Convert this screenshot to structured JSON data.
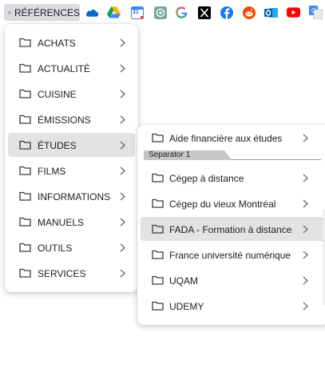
{
  "bookmarks_bar": {
    "folder_label": "RÉFÉRENCES",
    "icons": [
      "onedrive-icon",
      "google-drive-icon",
      "google-calendar-icon",
      "chatgpt-icon",
      "google-icon",
      "x-icon",
      "facebook-icon",
      "reddit-icon",
      "outlook-icon",
      "youtube-icon",
      "google-translate-icon"
    ],
    "calendar_day": "31"
  },
  "menu1": {
    "items": [
      {
        "label": "ACHATS"
      },
      {
        "label": "ACTUALITÉ"
      },
      {
        "label": "CUISINE"
      },
      {
        "label": "ÉMISSIONS"
      },
      {
        "label": "ÉTUDES",
        "active": true
      },
      {
        "label": "FILMS"
      },
      {
        "label": "INFORMATIONS"
      },
      {
        "label": "MANUELS"
      },
      {
        "label": "OUTILS"
      },
      {
        "label": "SERVICES"
      }
    ]
  },
  "menu2": {
    "first_item": "Aide financière aux études",
    "separator_label": "Separator 1",
    "items": [
      {
        "label": "Cégep à distance"
      },
      {
        "label": "Cégep du vieux Montréal"
      },
      {
        "label": "FADA - Formation à distance",
        "active": true
      },
      {
        "label": "France université numérique"
      },
      {
        "label": "UQAM"
      },
      {
        "label": "UDEMY"
      }
    ]
  },
  "colors": {
    "menu_bg": "#ffffff",
    "active_bg": "#e3e3e3",
    "button_bg": "#dadce0"
  }
}
